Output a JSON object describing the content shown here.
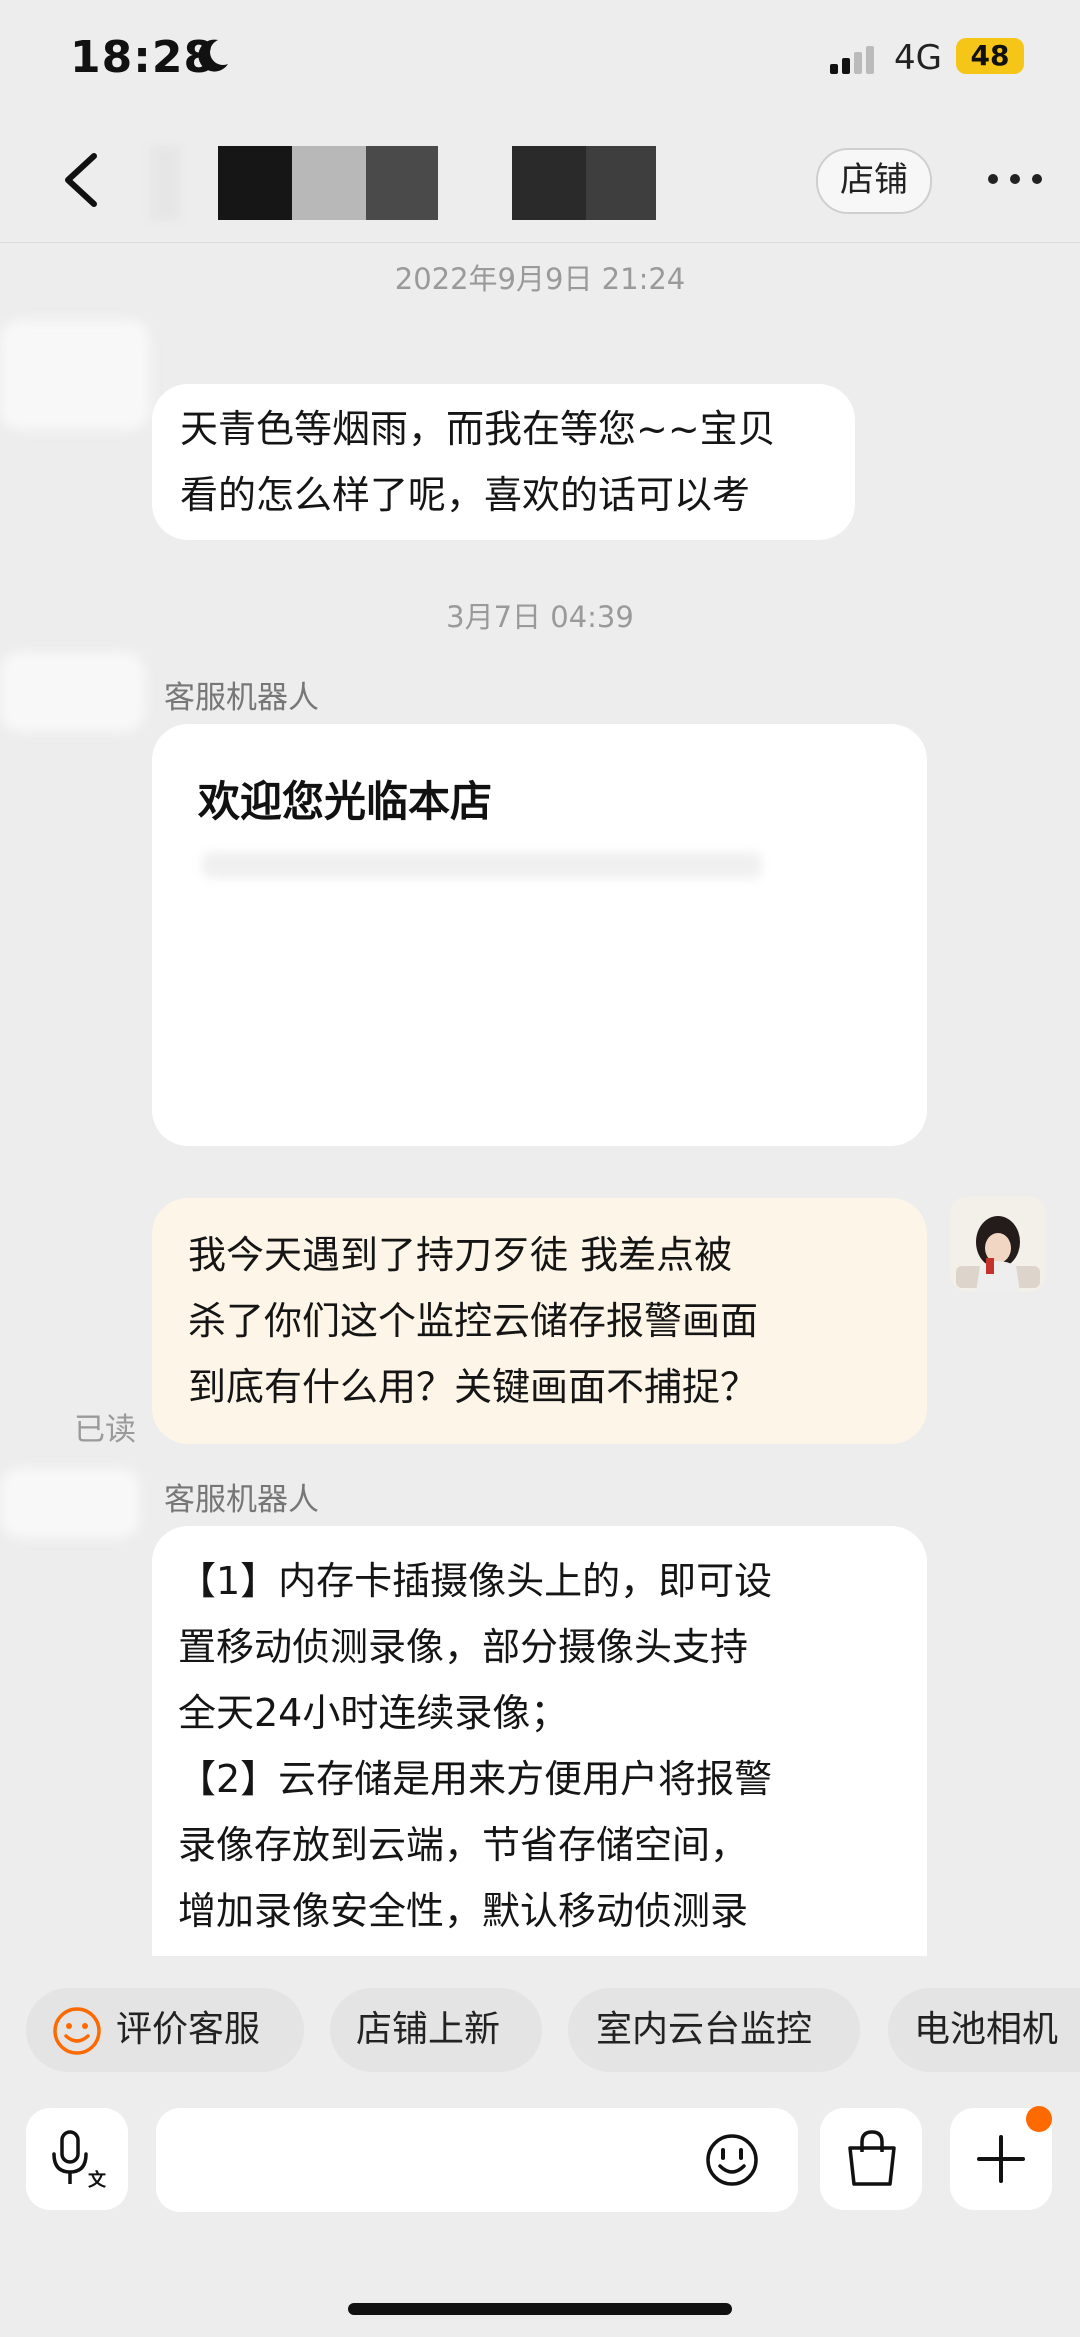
{
  "status_bar": {
    "time": "18:28",
    "network": "4G",
    "battery": "48"
  },
  "nav": {
    "store_label": "店铺"
  },
  "messages": [
    {
      "timestamp": "2022年9月9日 21:24",
      "text": "天青色等烟雨，而我在等您~~宝贝\n看的怎么样了呢，喜欢的话可以考"
    },
    {
      "timestamp": "3月7日 04:39",
      "sender": "客服机器人",
      "card_title": "欢迎您光临本店"
    },
    {
      "text": "我今天遇到了持刀歹徒 我差点被\n杀了你们这个监控云储存报警画面\n到底有什么用？关键画面不捕捉？",
      "read_status": "已读"
    },
    {
      "sender": "客服机器人",
      "text": "【1】内存卡插摄像头上的，即可设\n置移动侦测录像，部分摄像头支持\n全天24小时连续录像；\n【2】云存储是用来方便用户将报警\n录像存放到云端，节省存储空间，\n增加录像安全性，默认移动侦测录"
    }
  ],
  "quick_replies": [
    "评价客服",
    "店铺上新",
    "室内云台监控",
    "电池相机"
  ],
  "icons": {
    "mic": "mic-translate-icon",
    "emoji": "smile-icon",
    "bag": "shopping-bag-icon",
    "plus": "plus-icon",
    "rate": "smile-face-icon"
  },
  "colors": {
    "accent": "#ff6a00",
    "user_bubble": "#fdf5e8",
    "battery": "#f5c518"
  }
}
